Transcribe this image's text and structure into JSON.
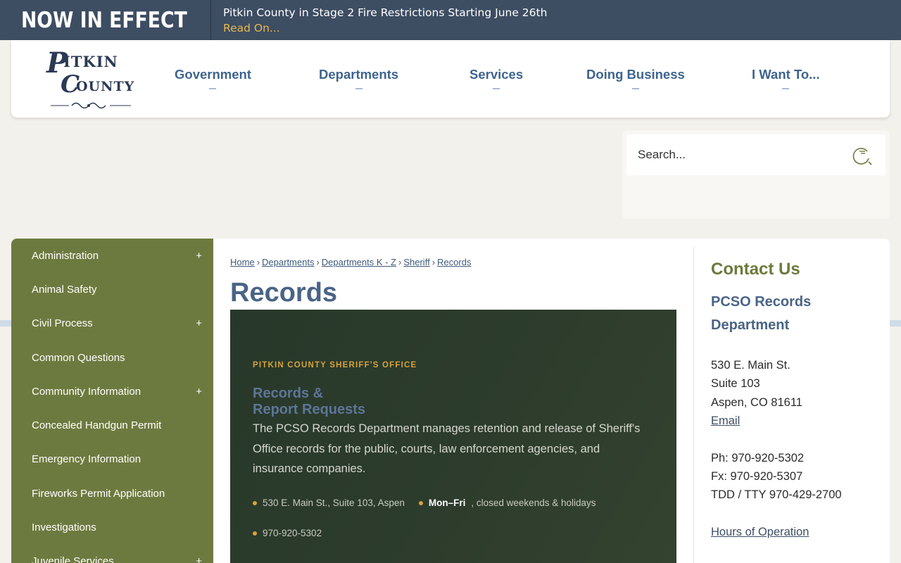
{
  "alert": {
    "label": "NOW IN EFFECT",
    "title": "Pitkin County in Stage 2 Fire Restrictions Starting June 26th",
    "link": "Read On..."
  },
  "header": {
    "logo_text": "Pitkin County",
    "nav": [
      "Government",
      "Departments",
      "Services",
      "Doing Business",
      "I Want To..."
    ]
  },
  "search": {
    "placeholder": "Search..."
  },
  "sidebar": {
    "items": [
      {
        "label": "Administration",
        "expandable": "+"
      },
      {
        "label": "Animal Safety",
        "expandable": ""
      },
      {
        "label": "Civil Process",
        "expandable": "+"
      },
      {
        "label": "Common Questions",
        "expandable": ""
      },
      {
        "label": "Community Information",
        "expandable": "+"
      },
      {
        "label": "Concealed Handgun Permit",
        "expandable": ""
      },
      {
        "label": "Emergency Information",
        "expandable": ""
      },
      {
        "label": "Fireworks Permit Application",
        "expandable": ""
      },
      {
        "label": "Investigations",
        "expandable": ""
      },
      {
        "label": "Juvenile Services",
        "expandable": "+"
      }
    ]
  },
  "breadcrumb": [
    "Home",
    "Departments",
    "Departments K - Z",
    "Sheriff",
    "Records"
  ],
  "page_title": "Records",
  "hero": {
    "kicker": "PITKIN COUNTY SHERIFF'S OFFICE",
    "heading_line1": "Records &",
    "heading_line2": "Report Requests",
    "description": "The PCSO Records Department manages retention and release of Sheriff's Office records for the public, courts, law enforcement agencies, and insurance companies.",
    "address": "530 E. Main St., Suite 103, Aspen",
    "hours_bold": "Mon–Fri",
    "hours_rest": ", closed weekends & holidays",
    "phone": "970-920-5302"
  },
  "contact": {
    "title": "Contact Us",
    "dept_line1": "PCSO Records",
    "dept_line2": "Department",
    "address1": "530 E. Main St.",
    "address2": "Suite 103",
    "address3": "Aspen, CO 81611",
    "email": "Email",
    "phone": "Ph: 970-920-5302",
    "fax": "Fx: 970-920-5307",
    "tdd": "TDD / TTY 970-429-2700",
    "hours_link": "Hours of Operation"
  },
  "colors": {
    "alert_bg": "#3d4d62",
    "accent_gold": "#e7b84b",
    "nav_blue": "#3e6490",
    "sidebar_green": "#6d7a3f",
    "hero_bg": "#2d3c2c"
  }
}
